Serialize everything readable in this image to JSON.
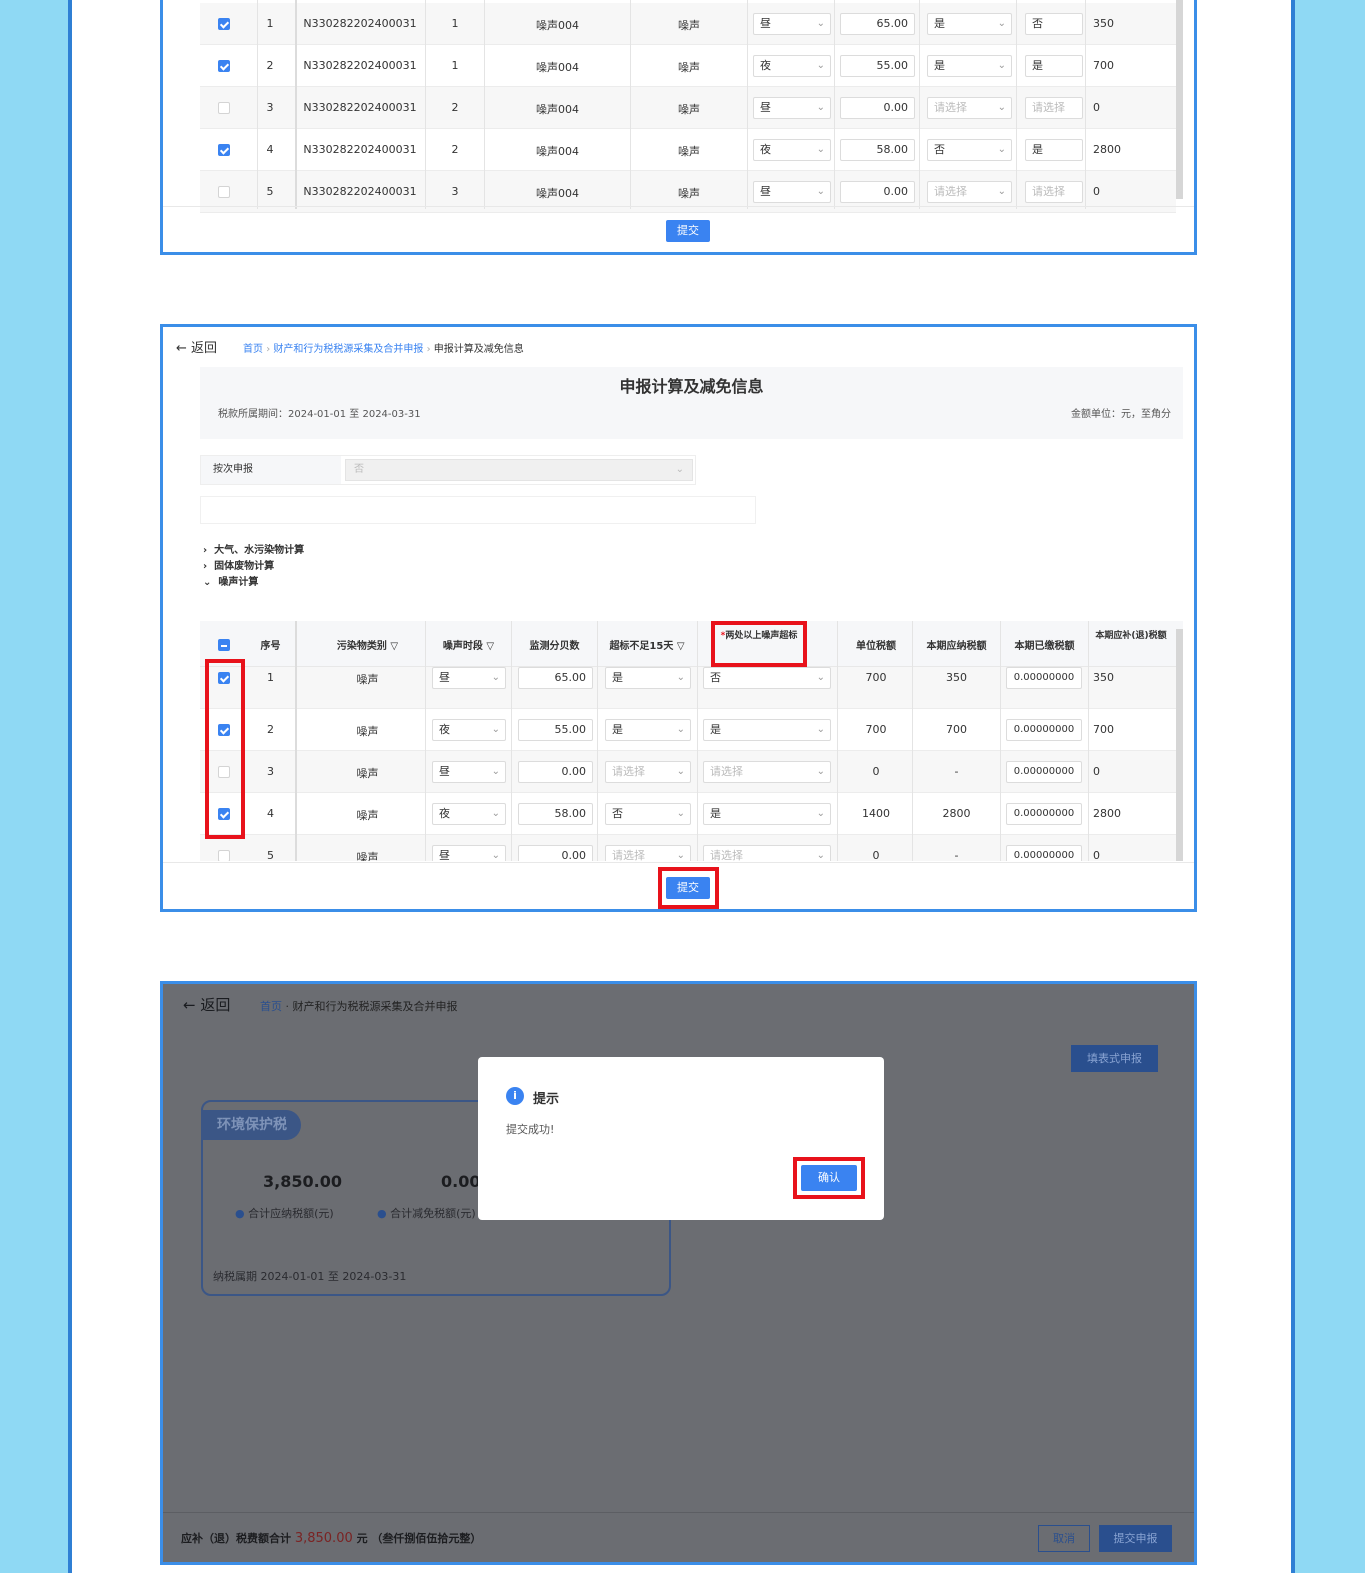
{
  "p1": {
    "rows": [
      {
        "no": "1",
        "code": "N330282202400031",
        "idx": "1",
        "name": "噪声004",
        "type": "噪声",
        "period": "昼",
        "db": "65.00",
        "under15": "是",
        "exceed": "否",
        "tax": "350",
        "checked": true,
        "under15_ph": false,
        "exceed_ph": false
      },
      {
        "no": "2",
        "code": "N330282202400031",
        "idx": "1",
        "name": "噪声004",
        "type": "噪声",
        "period": "夜",
        "db": "55.00",
        "under15": "是",
        "exceed": "是",
        "tax": "700",
        "checked": true,
        "under15_ph": false,
        "exceed_ph": false
      },
      {
        "no": "3",
        "code": "N330282202400031",
        "idx": "2",
        "name": "噪声004",
        "type": "噪声",
        "period": "昼",
        "db": "0.00",
        "under15": "请选择",
        "exceed": "请选择",
        "tax": "0",
        "checked": false,
        "under15_ph": true,
        "exceed_ph": true
      },
      {
        "no": "4",
        "code": "N330282202400031",
        "idx": "2",
        "name": "噪声004",
        "type": "噪声",
        "period": "夜",
        "db": "58.00",
        "under15": "否",
        "exceed": "是",
        "tax": "2800",
        "checked": true,
        "under15_ph": false,
        "exceed_ph": false
      },
      {
        "no": "5",
        "code": "N330282202400031",
        "idx": "3",
        "name": "噪声004",
        "type": "噪声",
        "period": "昼",
        "db": "0.00",
        "under15": "请选择",
        "exceed": "请选择",
        "tax": "0",
        "checked": false,
        "under15_ph": true,
        "exceed_ph": true
      }
    ],
    "submit": "提交"
  },
  "p2": {
    "back": "返回",
    "bc_home": "首页",
    "bc_mid": "财产和行为税税源采集及合并申报",
    "bc_cur": "申报计算及减免信息",
    "title": "申报计算及减免信息",
    "period": "税款所属期间：2024-01-01 至 2024-03-31",
    "unit": "金额单位：元，至角分",
    "per_label": "按次申报",
    "per_value": "否",
    "sec1": "大气、水污染物计算",
    "sec2": "固体废物计算",
    "sec3": "噪声计算",
    "headers": {
      "no": "序号",
      "type": "污染物类别",
      "period": "噪声时段",
      "db": "监测分贝数",
      "under15": "超标不足15天",
      "exceed": "两处以上噪声超标",
      "unit": "单位税额",
      "due": "本期应纳税额",
      "paid": "本期已缴税额",
      "diff": "本期应补(退)税额"
    },
    "required_mark": "*",
    "rows": [
      {
        "no": "1",
        "type": "噪声",
        "period": "昼",
        "db": "65.00",
        "under15": "是",
        "exceed": "否",
        "unit": "700",
        "due": "350",
        "paid": "0.00000000",
        "diff": "350",
        "checked": true,
        "under15_ph": false,
        "exceed_ph": false
      },
      {
        "no": "2",
        "type": "噪声",
        "period": "夜",
        "db": "55.00",
        "under15": "是",
        "exceed": "是",
        "unit": "700",
        "due": "700",
        "paid": "0.00000000",
        "diff": "700",
        "checked": true,
        "under15_ph": false,
        "exceed_ph": false
      },
      {
        "no": "3",
        "type": "噪声",
        "period": "昼",
        "db": "0.00",
        "under15": "请选择",
        "exceed": "请选择",
        "unit": "0",
        "due": "-",
        "paid": "0.00000000",
        "diff": "0",
        "checked": false,
        "under15_ph": true,
        "exceed_ph": true
      },
      {
        "no": "4",
        "type": "噪声",
        "period": "夜",
        "db": "58.00",
        "under15": "否",
        "exceed": "是",
        "unit": "1400",
        "due": "2800",
        "paid": "0.00000000",
        "diff": "2800",
        "checked": true,
        "under15_ph": false,
        "exceed_ph": false
      },
      {
        "no": "5",
        "type": "噪声",
        "period": "昼",
        "db": "0.00",
        "under15": "请选择",
        "exceed": "请选择",
        "unit": "0",
        "due": "-",
        "paid": "0.00000000",
        "diff": "0",
        "checked": false,
        "under15_ph": true,
        "exceed_ph": true
      }
    ],
    "submit": "提交"
  },
  "p3": {
    "back": "返回",
    "bc_home": "首页",
    "bc_mid": "财产和行为税税源采集及合并申报",
    "fill_btn": "填表式申报",
    "card_tag": "环境保护税",
    "amount_due": "3,850.00",
    "amount_due_label": "合计应纳税额(元)",
    "amount_relief": "0.00",
    "amount_relief_label": "合计减免税额(元)",
    "card_period": "纳税属期 2024-01-01 至 2024-03-31",
    "total_label": "应补（退）税费额合计",
    "total_value": "3,850.00",
    "total_unit": "元",
    "total_words": "（叁仟捌佰伍拾元整）",
    "cancel": "取消",
    "submit": "提交申报",
    "dialog_title": "提示",
    "dialog_msg": "提交成功!",
    "dialog_confirm": "确认"
  },
  "colors": {
    "accent": "#3a83f1",
    "frame": "#3b8ee8",
    "highlight": "#e8121b",
    "side": "#8fd9f4",
    "amount_red": "#e23d3d"
  }
}
